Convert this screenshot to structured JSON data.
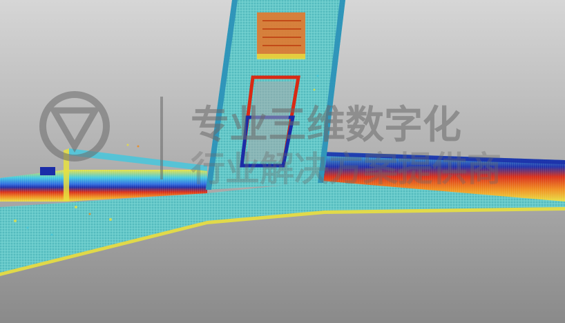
{
  "scene": {
    "kind": "point-cloud-viewer",
    "background_top": "#d4d4d4",
    "background_bottom": "#8e8e8e",
    "ground_color": "#64c8c8",
    "elevation_colors": [
      "#1a2ca8",
      "#2a6ae0",
      "#40c8e0",
      "#e8e040",
      "#f08a1a",
      "#d82a14"
    ]
  },
  "watermark": {
    "line1": "专业三维数字化",
    "line2": "行业解决方案提供商",
    "logo_text": "",
    "color": "#6a6a6a",
    "opacity": 0.55
  }
}
